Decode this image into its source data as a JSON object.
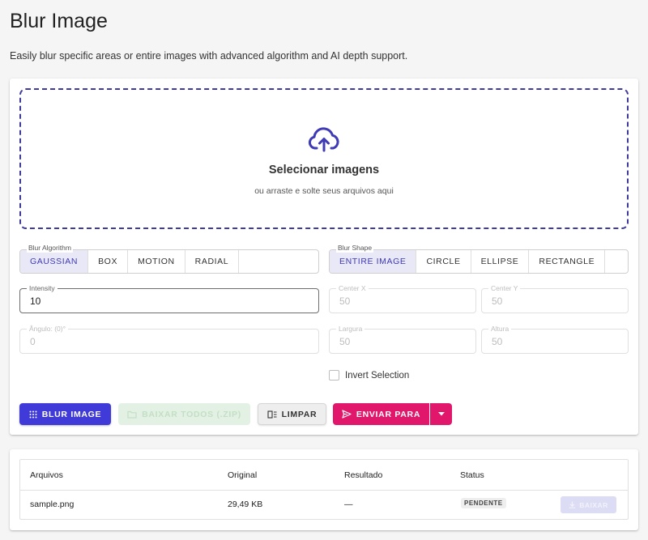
{
  "header": {
    "title": "Blur Image",
    "description": "Easily blur specific areas or entire images with advanced algorithm and AI depth support."
  },
  "dropzone": {
    "title": "Selecionar imagens",
    "subtitle": "ou arraste e solte seus arquivos aqui",
    "icon": "cloud-upload-icon"
  },
  "algorithm": {
    "label": "Blur Algorithm",
    "options": [
      "GAUSSIAN",
      "BOX",
      "MOTION",
      "RADIAL"
    ],
    "selected": "GAUSSIAN"
  },
  "shape": {
    "label": "Blur Shape",
    "options": [
      "ENTIRE IMAGE",
      "CIRCLE",
      "ELLIPSE",
      "RECTANGLE"
    ],
    "selected": "ENTIRE IMAGE"
  },
  "fields": {
    "intensity": {
      "label": "Intensity",
      "value": "10"
    },
    "center_x": {
      "label": "Center X",
      "value": "50"
    },
    "center_y": {
      "label": "Center Y",
      "value": "50"
    },
    "angle": {
      "label": "Ângulo: (0)°",
      "value": "0"
    },
    "width": {
      "label": "Largura",
      "value": "50"
    },
    "height": {
      "label": "Altura",
      "value": "50"
    }
  },
  "invert": {
    "label": "Invert Selection",
    "checked": false
  },
  "actions": {
    "blur": "BLUR IMAGE",
    "zip": "BAIXAR TODOS (.ZIP)",
    "clear": "LIMPAR",
    "send": "ENVIAR PARA"
  },
  "table": {
    "headers": [
      "Arquivos",
      "Original",
      "Resultado",
      "Status"
    ],
    "rows": [
      {
        "file": "sample.png",
        "original": "29,49 KB",
        "result": "—",
        "status": "PENDENTE",
        "action": "BAIXAR"
      }
    ]
  },
  "colors": {
    "primary": "#3f3ad8",
    "accent": "#e0176b",
    "dashed_border": "#3f3a9e"
  }
}
